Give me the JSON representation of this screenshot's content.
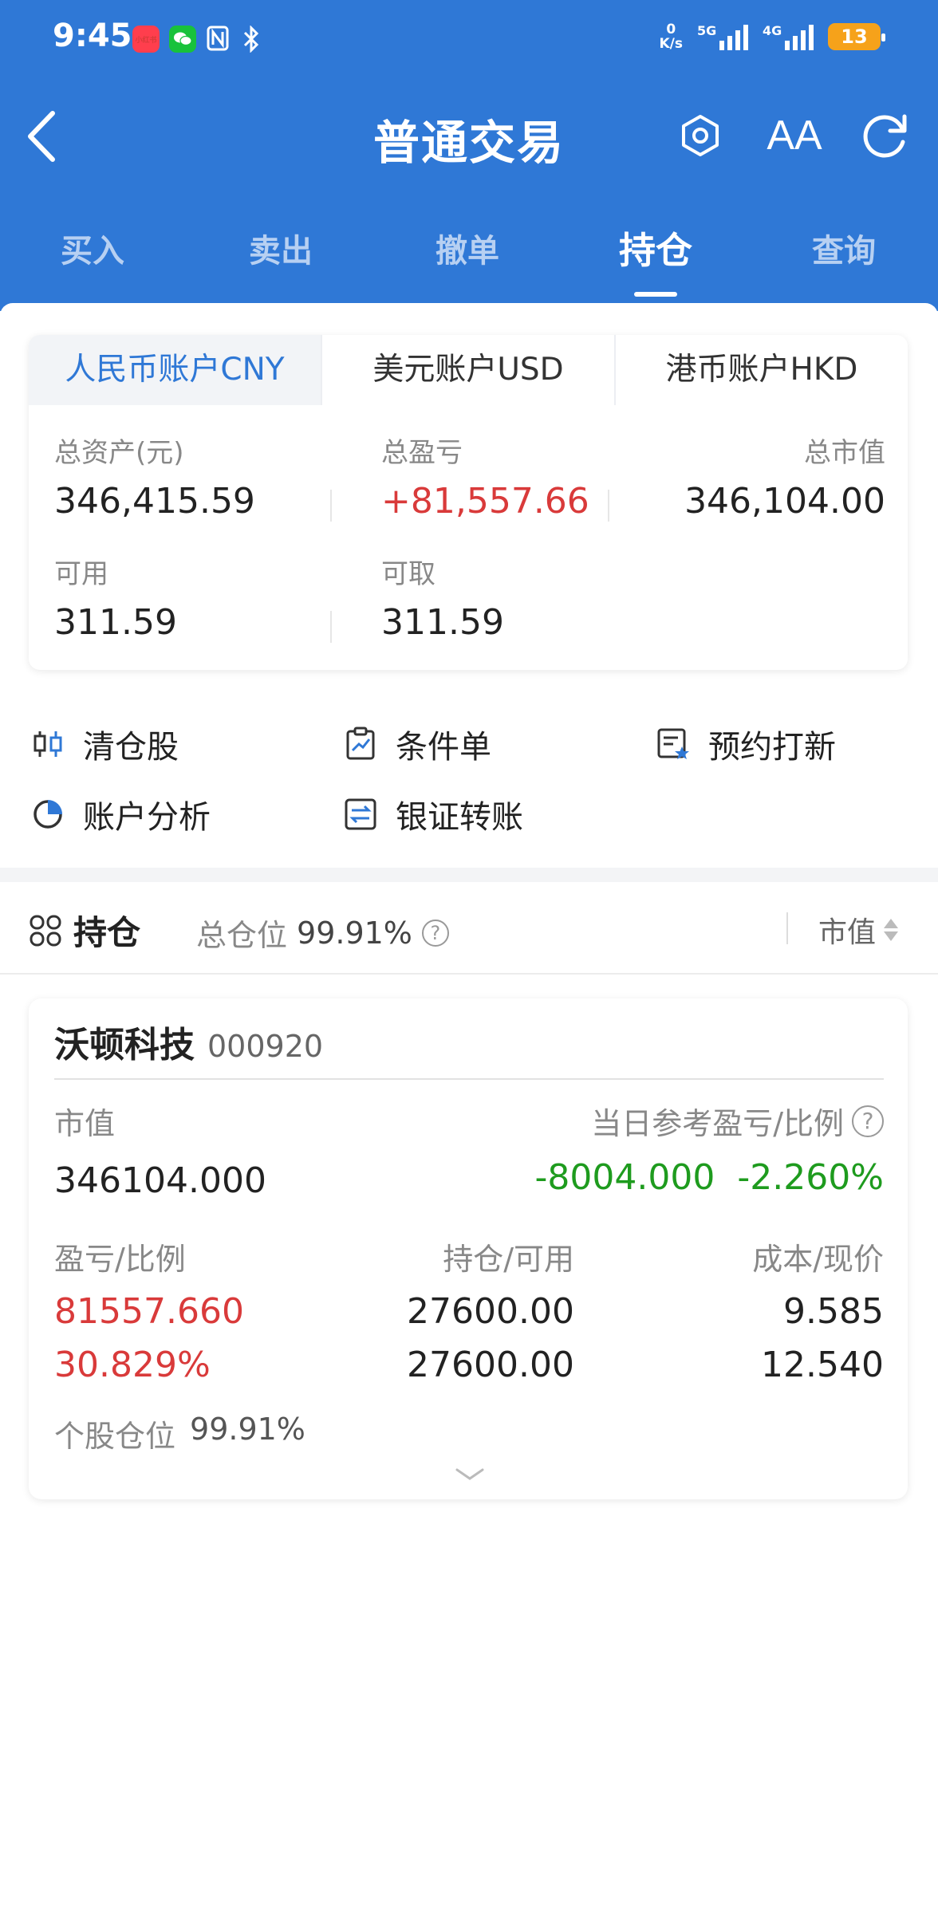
{
  "status": {
    "time": "9:45",
    "app_badge": "小红书",
    "net_speed_top": "0",
    "net_speed_unit": "K/s",
    "signal1": "5G",
    "signal2": "4G",
    "battery": "13"
  },
  "header": {
    "title": "普通交易",
    "font_icon_label": "AA"
  },
  "tabs": [
    {
      "label": "买入"
    },
    {
      "label": "卖出"
    },
    {
      "label": "撤单"
    },
    {
      "label": "持仓"
    },
    {
      "label": "查询"
    }
  ],
  "active_tab": "持仓",
  "account_tabs": [
    {
      "label": "人民币账户CNY"
    },
    {
      "label": "美元账户USD"
    },
    {
      "label": "港币账户HKD"
    }
  ],
  "account": {
    "total_assets_label": "总资产(元)",
    "total_assets": "346,415.59",
    "total_pnl_label": "总盈亏",
    "total_pnl": "+81,557.66",
    "total_mv_label": "总市值",
    "total_mv": "346,104.00",
    "available_label": "可用",
    "available": "311.59",
    "withdrawable_label": "可取",
    "withdrawable": "311.59"
  },
  "shortcuts": [
    {
      "label": "清仓股",
      "icon": "candlestick-icon"
    },
    {
      "label": "条件单",
      "icon": "clipboard-chart-icon"
    },
    {
      "label": "预约打新",
      "icon": "calendar-star-icon"
    },
    {
      "label": "账户分析",
      "icon": "pie-chart-icon"
    },
    {
      "label": "银证转账",
      "icon": "transfer-icon"
    }
  ],
  "positions": {
    "title": "持仓",
    "total_label": "总仓位",
    "total_value": "99.91%",
    "sort_label": "市值"
  },
  "stock": {
    "name": "沃顿科技",
    "code": "000920",
    "mv_label": "市值",
    "mv": "346104.000",
    "daily_label": "当日参考盈亏/比例",
    "daily_pnl": "-8004.000",
    "daily_ratio": "-2.260%",
    "pnl_label": "盈亏/比例",
    "pnl": "81557.660",
    "pnl_ratio": "30.829%",
    "hold_label": "持仓/可用",
    "hold": "27600.00",
    "available": "27600.00",
    "cost_label": "成本/现价",
    "cost": "9.585",
    "price": "12.540",
    "weight_label": "个股仓位",
    "weight": "99.91%"
  },
  "colors": {
    "brand_blue": "#2f78d6",
    "gain_red": "#d93a3a",
    "loss_green": "#1e9b1e"
  }
}
